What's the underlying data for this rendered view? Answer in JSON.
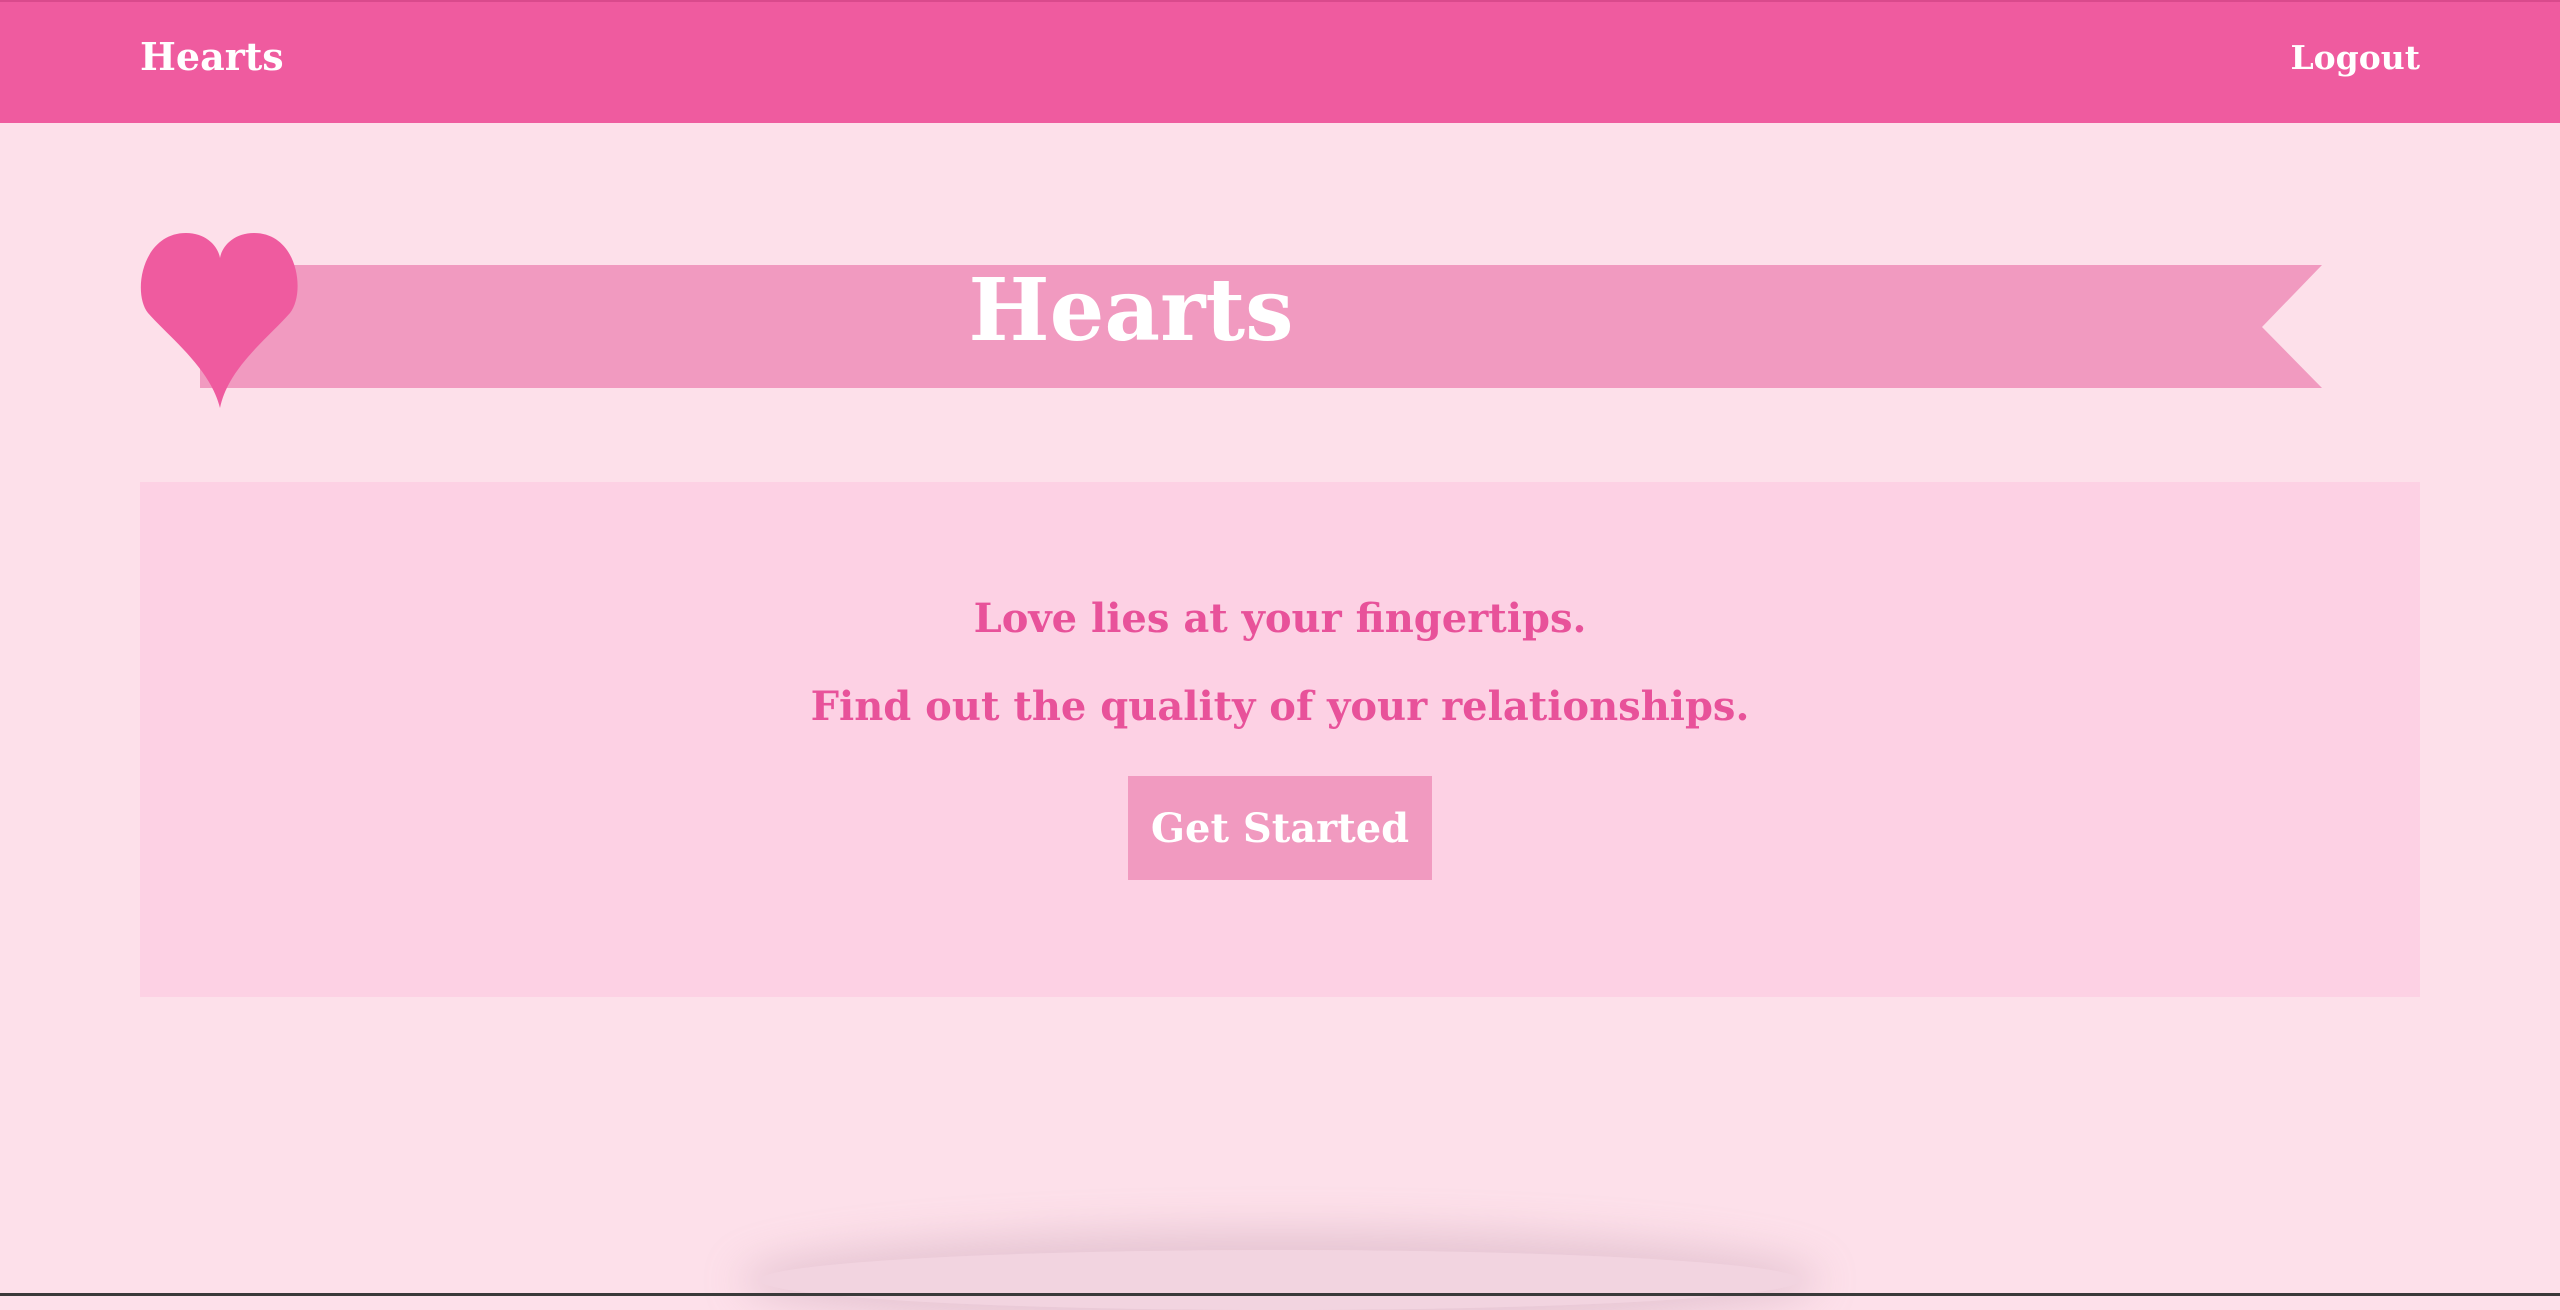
{
  "navbar": {
    "brand": "Hearts",
    "logout_label": "Logout"
  },
  "banner": {
    "title": "Hearts",
    "icon": "heart-icon"
  },
  "hero": {
    "line1": "Love lies at your fingertips.",
    "line2": "Find out the quality of your relationships.",
    "cta_label": "Get Started"
  },
  "colors": {
    "navbar": "#ef5b9f",
    "page_background": "#fde0ea",
    "ribbon": "#f19ac0",
    "heart": "#ef5b9f",
    "hero_background": "#fdd1e4",
    "tagline_text": "#e8529a",
    "button": "#f19ac0"
  }
}
